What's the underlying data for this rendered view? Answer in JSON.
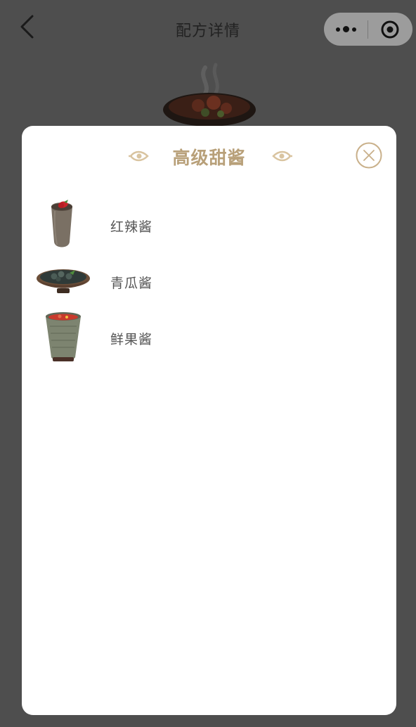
{
  "nav": {
    "title": "配方详情",
    "back_icon": "chevron-left-icon",
    "more_icon": "more-dots-icon",
    "close_icon": "target-circle-icon"
  },
  "modal": {
    "title": "高级甜酱",
    "close_icon": "close-circle-icon",
    "accent_color": "#b8a079",
    "items": [
      {
        "name": "红辣酱",
        "icon": "chili-sauce-jar-icon"
      },
      {
        "name": "青瓜酱",
        "icon": "cucumber-sauce-bowl-icon"
      },
      {
        "name": "鲜果酱",
        "icon": "fruit-sauce-cup-icon"
      }
    ]
  },
  "colors": {
    "overlay": "#4e4e4e",
    "modal_bg": "#ffffff",
    "title_gold": "#b8a079",
    "item_text": "#555555"
  }
}
